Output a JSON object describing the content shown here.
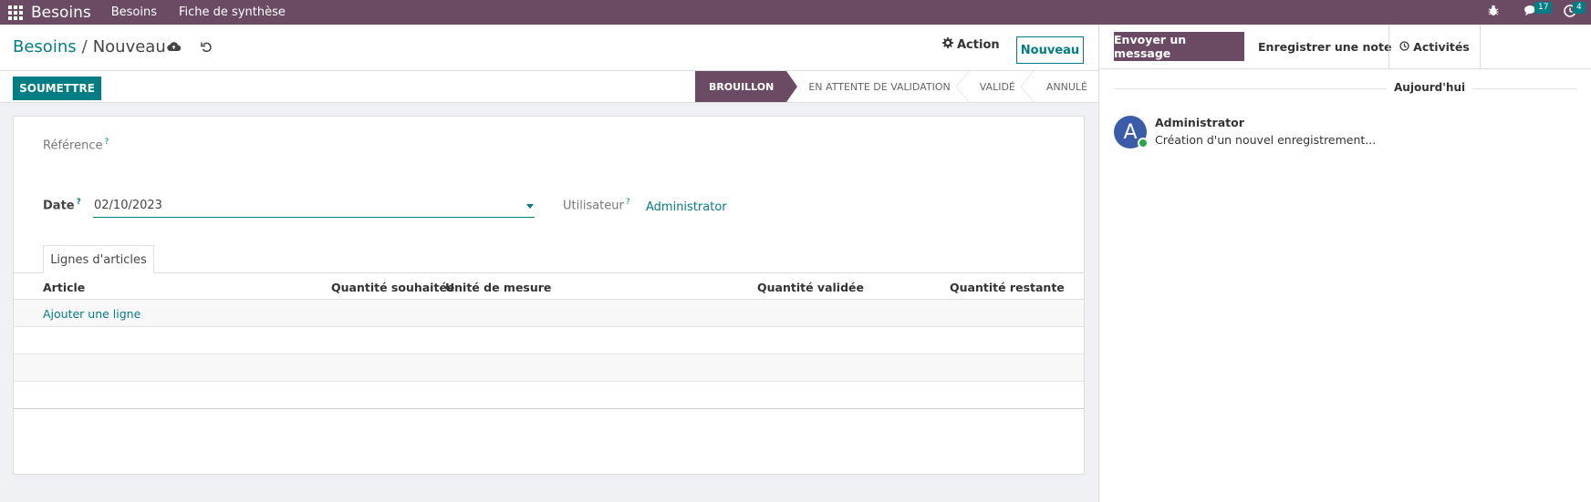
{
  "navbar": {
    "brand": "Besoins",
    "menu": [
      "Besoins",
      "Fiche de synthèse"
    ],
    "chat_count": "17",
    "activity_count": "4"
  },
  "breadcrumb": {
    "parent": "Besoins",
    "separator": "/",
    "current": "Nouveau"
  },
  "control": {
    "action_label": "Action",
    "new_label": "Nouveau"
  },
  "statusbar": {
    "submit_label": "SOUMETTRE",
    "stages": [
      "BROUILLON",
      "EN ATTENTE DE VALIDATION",
      "VALIDÉ",
      "ANNULÉ"
    ],
    "active_stage": "BROUILLON"
  },
  "form": {
    "reference_label": "Référence",
    "help_mark": "?",
    "date_label": "Date",
    "date_value": "02/10/2023",
    "user_label": "Utilisateur",
    "user_value": "Administrator"
  },
  "tabs": {
    "lines_label": "Lignes d'articles"
  },
  "table": {
    "columns": [
      "Article",
      "Quantité souhaitée",
      "Unité de mesure",
      "Quantité validée",
      "Quantité restante"
    ],
    "add_line": "Ajouter une ligne"
  },
  "chatter": {
    "send_message": "Envoyer un message",
    "log_note": "Enregistrer une note",
    "activities": "Activités",
    "day": "Aujourd'hui",
    "avatar_initial": "A",
    "author": "Administrator",
    "message": "Création d'un nouvel enregistrement..."
  },
  "colors": {
    "brand": "#6b4a63",
    "accent": "#017e84"
  }
}
